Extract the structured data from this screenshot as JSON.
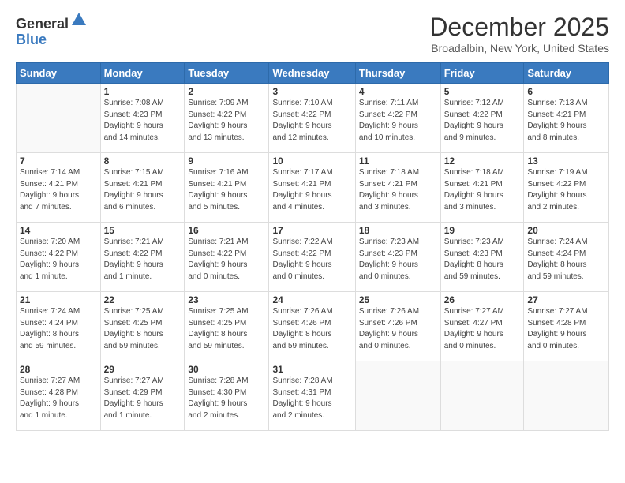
{
  "header": {
    "logo_general": "General",
    "logo_blue": "Blue",
    "month_title": "December 2025",
    "location": "Broadalbin, New York, United States"
  },
  "days_of_week": [
    "Sunday",
    "Monday",
    "Tuesday",
    "Wednesday",
    "Thursday",
    "Friday",
    "Saturday"
  ],
  "weeks": [
    [
      {
        "day": "",
        "info": ""
      },
      {
        "day": "1",
        "info": "Sunrise: 7:08 AM\nSunset: 4:23 PM\nDaylight: 9 hours\nand 14 minutes."
      },
      {
        "day": "2",
        "info": "Sunrise: 7:09 AM\nSunset: 4:22 PM\nDaylight: 9 hours\nand 13 minutes."
      },
      {
        "day": "3",
        "info": "Sunrise: 7:10 AM\nSunset: 4:22 PM\nDaylight: 9 hours\nand 12 minutes."
      },
      {
        "day": "4",
        "info": "Sunrise: 7:11 AM\nSunset: 4:22 PM\nDaylight: 9 hours\nand 10 minutes."
      },
      {
        "day": "5",
        "info": "Sunrise: 7:12 AM\nSunset: 4:22 PM\nDaylight: 9 hours\nand 9 minutes."
      },
      {
        "day": "6",
        "info": "Sunrise: 7:13 AM\nSunset: 4:21 PM\nDaylight: 9 hours\nand 8 minutes."
      }
    ],
    [
      {
        "day": "7",
        "info": "Sunrise: 7:14 AM\nSunset: 4:21 PM\nDaylight: 9 hours\nand 7 minutes."
      },
      {
        "day": "8",
        "info": "Sunrise: 7:15 AM\nSunset: 4:21 PM\nDaylight: 9 hours\nand 6 minutes."
      },
      {
        "day": "9",
        "info": "Sunrise: 7:16 AM\nSunset: 4:21 PM\nDaylight: 9 hours\nand 5 minutes."
      },
      {
        "day": "10",
        "info": "Sunrise: 7:17 AM\nSunset: 4:21 PM\nDaylight: 9 hours\nand 4 minutes."
      },
      {
        "day": "11",
        "info": "Sunrise: 7:18 AM\nSunset: 4:21 PM\nDaylight: 9 hours\nand 3 minutes."
      },
      {
        "day": "12",
        "info": "Sunrise: 7:18 AM\nSunset: 4:21 PM\nDaylight: 9 hours\nand 3 minutes."
      },
      {
        "day": "13",
        "info": "Sunrise: 7:19 AM\nSunset: 4:22 PM\nDaylight: 9 hours\nand 2 minutes."
      }
    ],
    [
      {
        "day": "14",
        "info": "Sunrise: 7:20 AM\nSunset: 4:22 PM\nDaylight: 9 hours\nand 1 minute."
      },
      {
        "day": "15",
        "info": "Sunrise: 7:21 AM\nSunset: 4:22 PM\nDaylight: 9 hours\nand 1 minute."
      },
      {
        "day": "16",
        "info": "Sunrise: 7:21 AM\nSunset: 4:22 PM\nDaylight: 9 hours\nand 0 minutes."
      },
      {
        "day": "17",
        "info": "Sunrise: 7:22 AM\nSunset: 4:22 PM\nDaylight: 9 hours\nand 0 minutes."
      },
      {
        "day": "18",
        "info": "Sunrise: 7:23 AM\nSunset: 4:23 PM\nDaylight: 9 hours\nand 0 minutes."
      },
      {
        "day": "19",
        "info": "Sunrise: 7:23 AM\nSunset: 4:23 PM\nDaylight: 8 hours\nand 59 minutes."
      },
      {
        "day": "20",
        "info": "Sunrise: 7:24 AM\nSunset: 4:24 PM\nDaylight: 8 hours\nand 59 minutes."
      }
    ],
    [
      {
        "day": "21",
        "info": "Sunrise: 7:24 AM\nSunset: 4:24 PM\nDaylight: 8 hours\nand 59 minutes."
      },
      {
        "day": "22",
        "info": "Sunrise: 7:25 AM\nSunset: 4:25 PM\nDaylight: 8 hours\nand 59 minutes."
      },
      {
        "day": "23",
        "info": "Sunrise: 7:25 AM\nSunset: 4:25 PM\nDaylight: 8 hours\nand 59 minutes."
      },
      {
        "day": "24",
        "info": "Sunrise: 7:26 AM\nSunset: 4:26 PM\nDaylight: 8 hours\nand 59 minutes."
      },
      {
        "day": "25",
        "info": "Sunrise: 7:26 AM\nSunset: 4:26 PM\nDaylight: 9 hours\nand 0 minutes."
      },
      {
        "day": "26",
        "info": "Sunrise: 7:27 AM\nSunset: 4:27 PM\nDaylight: 9 hours\nand 0 minutes."
      },
      {
        "day": "27",
        "info": "Sunrise: 7:27 AM\nSunset: 4:28 PM\nDaylight: 9 hours\nand 0 minutes."
      }
    ],
    [
      {
        "day": "28",
        "info": "Sunrise: 7:27 AM\nSunset: 4:28 PM\nDaylight: 9 hours\nand 1 minute."
      },
      {
        "day": "29",
        "info": "Sunrise: 7:27 AM\nSunset: 4:29 PM\nDaylight: 9 hours\nand 1 minute."
      },
      {
        "day": "30",
        "info": "Sunrise: 7:28 AM\nSunset: 4:30 PM\nDaylight: 9 hours\nand 2 minutes."
      },
      {
        "day": "31",
        "info": "Sunrise: 7:28 AM\nSunset: 4:31 PM\nDaylight: 9 hours\nand 2 minutes."
      },
      {
        "day": "",
        "info": ""
      },
      {
        "day": "",
        "info": ""
      },
      {
        "day": "",
        "info": ""
      }
    ]
  ]
}
